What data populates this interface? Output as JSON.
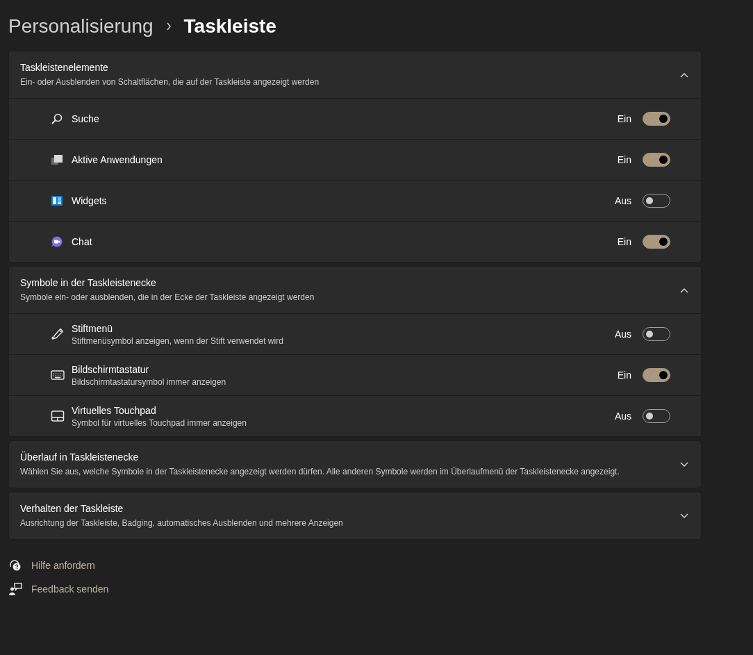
{
  "breadcrumb": {
    "parent": "Personalisierung",
    "current": "Taskleiste"
  },
  "sections": [
    {
      "title": "Taskleistenelemente",
      "description": "Ein- oder Ausblenden von Schaltflächen, die auf der Taskleiste angezeigt werden",
      "expanded": true,
      "items": [
        {
          "kind": "search",
          "label": "Suche",
          "state_label": "Ein",
          "on": true
        },
        {
          "kind": "taskview",
          "label": "Aktive Anwendungen",
          "state_label": "Ein",
          "on": true
        },
        {
          "kind": "widgets",
          "label": "Widgets",
          "state_label": "Aus",
          "on": false
        },
        {
          "kind": "chat",
          "label": "Chat",
          "state_label": "Ein",
          "on": true
        }
      ]
    },
    {
      "title": "Symbole in der Taskleistenecke",
      "description": "Symbole ein- oder ausblenden, die in der Ecke der Taskleiste angezeigt werden",
      "expanded": true,
      "items": [
        {
          "kind": "pen",
          "label": "Stiftmenü",
          "description": "Stiftmenüsymbol anzeigen, wenn der Stift verwendet wird",
          "state_label": "Aus",
          "on": false
        },
        {
          "kind": "keyboard",
          "label": "Bildschirmtastatur",
          "description": "Bildschirmtastatursymbol immer anzeigen",
          "state_label": "Ein",
          "on": true
        },
        {
          "kind": "touchpad",
          "label": "Virtuelles Touchpad",
          "description": "Symbol für virtuelles Touchpad immer anzeigen",
          "state_label": "Aus",
          "on": false
        }
      ]
    },
    {
      "title": "Überlauf in Taskleistenecke",
      "description": "Wählen Sie aus, welche Symbole in der Taskleistenecke angezeigt werden dürfen. Alle anderen Symbole werden im Überlaufmenü der Taskleistenecke angezeigt.",
      "expanded": false
    },
    {
      "title": "Verhalten der Taskleiste",
      "description": "Ausrichtung der Taskleiste, Badging, automatisches Ausblenden und mehrere Anzeigen",
      "expanded": false
    }
  ],
  "links": [
    {
      "kind": "help",
      "label": "Hilfe anfordern"
    },
    {
      "kind": "feedback",
      "label": "Feedback senden"
    }
  ]
}
